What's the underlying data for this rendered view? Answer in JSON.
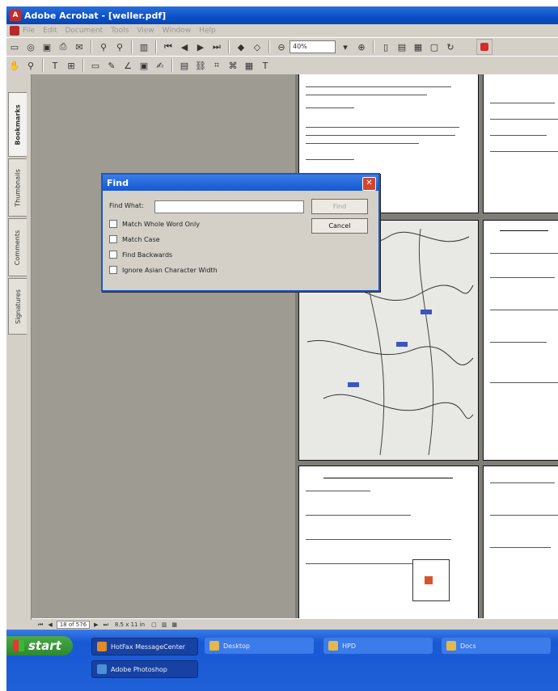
{
  "window": {
    "title": "Adobe Acrobat - [weller.pdf]"
  },
  "menu": [
    "File",
    "Edit",
    "Document",
    "Tools",
    "View",
    "Window",
    "Help"
  ],
  "toolbar": {
    "zoom": "40%"
  },
  "side_tabs": [
    "Bookmarks",
    "Thumbnails",
    "Comments",
    "Signatures"
  ],
  "find_dialog": {
    "title": "Find",
    "find_what_label": "Find What:",
    "find_what_value": "",
    "find_button": "Find",
    "cancel_button": "Cancel",
    "options": [
      "Match Whole Word Only",
      "Match Case",
      "Find Backwards",
      "Ignore Asian Character Width"
    ]
  },
  "statusbar": {
    "page": "18 of 576",
    "size": "8.5 x 11 in"
  },
  "taskbar": {
    "start": "start",
    "tasks": [
      "HotFax MessageCenter",
      "Desktop",
      "HPD",
      "Docs",
      "Adobe Photoshop"
    ]
  },
  "colors": {
    "titlebar": "#0a4fc8",
    "taskbar": "#1f60d8",
    "start": "#2c8a2c",
    "close": "#d6452a"
  }
}
